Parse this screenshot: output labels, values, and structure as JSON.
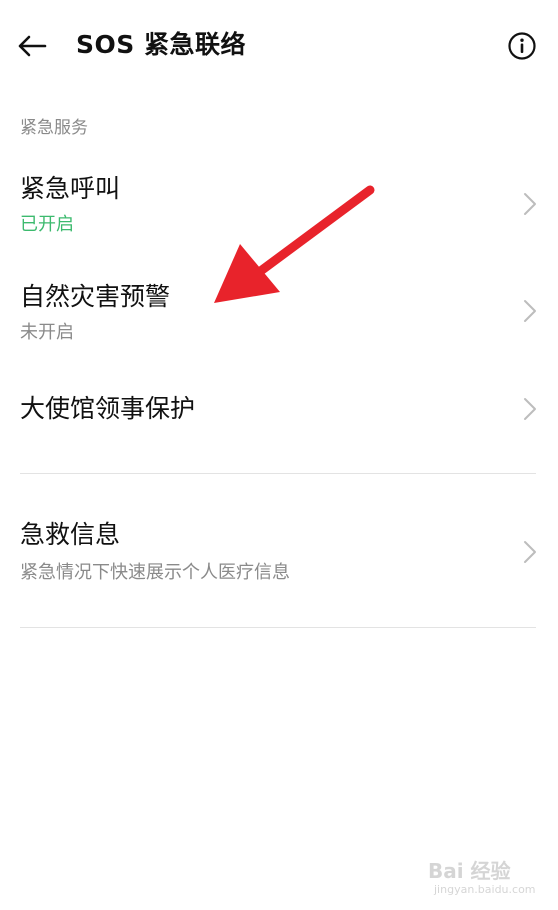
{
  "header": {
    "title": "SOS 紧急联络",
    "back_icon": "arrow-left-icon",
    "info_icon": "info-circle-icon"
  },
  "section": {
    "label": "紧急服务"
  },
  "items": [
    {
      "title": "紧急呼叫",
      "subtitle": "已开启",
      "subtitle_color": "#3cba6e"
    },
    {
      "title": "自然灾害预警",
      "subtitle": "未开启"
    },
    {
      "title": "大使馆领事保护",
      "subtitle": ""
    },
    {
      "title": "急救信息",
      "subtitle": "紧急情况下快速展示个人医疗信息"
    }
  ],
  "annotation": {
    "arrow_color": "#e8232b"
  },
  "watermark": {
    "text": "Bai 经验",
    "url": "jingyan.baidu.com"
  }
}
